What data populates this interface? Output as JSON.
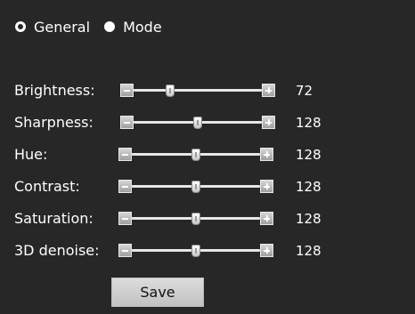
{
  "tabs": [
    {
      "label": "General",
      "selected": true
    },
    {
      "label": "Mode",
      "selected": false
    }
  ],
  "settings": [
    {
      "label": "Brightness:",
      "value": "72"
    },
    {
      "label": "Sharpness:",
      "value": "128"
    },
    {
      "label": "Hue:",
      "value": "128"
    },
    {
      "label": "Contrast:",
      "value": "128"
    },
    {
      "label": "Saturation:",
      "value": "128"
    },
    {
      "label": "3D denoise:",
      "value": "128"
    }
  ],
  "slider_max": 255,
  "save_label": "Save",
  "icons": {
    "decrease": "minus-icon",
    "increase": "plus-icon",
    "radio": "radio-icon"
  },
  "colors": {
    "background": "#272727",
    "text": "#ffffff",
    "button": "#c8c8c8"
  }
}
